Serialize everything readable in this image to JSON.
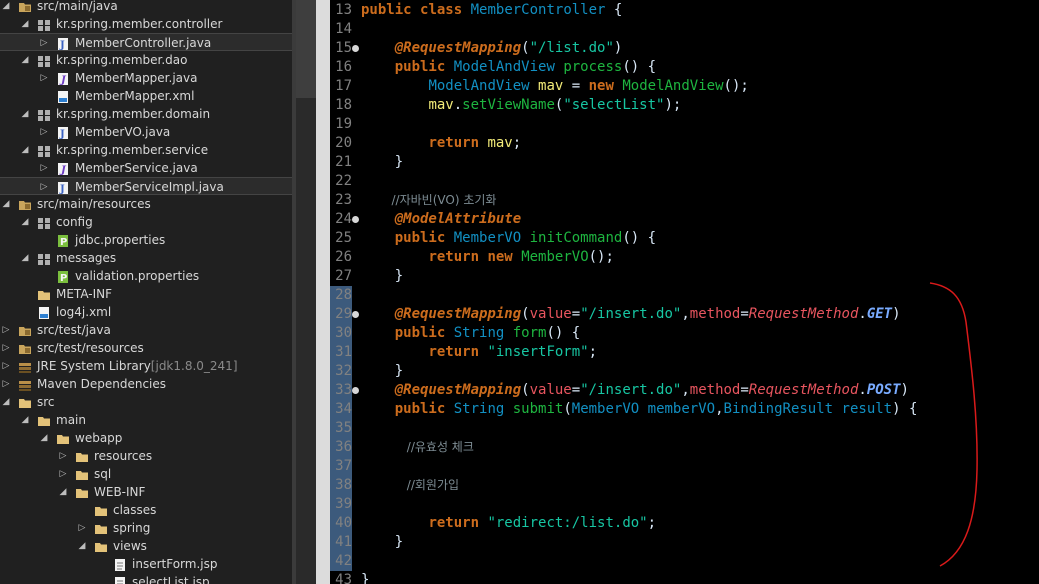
{
  "explorer": {
    "items": [
      {
        "label": "src/main/java",
        "depth": 1,
        "arrow": "down",
        "icon": "package-folder",
        "dim": ""
      },
      {
        "label": "kr.spring.member.controller",
        "depth": 2,
        "arrow": "down",
        "icon": "package",
        "dim": ""
      },
      {
        "label": "MemberController.java",
        "depth": 3,
        "arrow": "right",
        "icon": "java-file",
        "dim": "",
        "selected": true
      },
      {
        "label": "kr.spring.member.dao",
        "depth": 2,
        "arrow": "down",
        "icon": "package",
        "dim": ""
      },
      {
        "label": "MemberMapper.java",
        "depth": 3,
        "arrow": "right",
        "icon": "java-interface",
        "dim": ""
      },
      {
        "label": "MemberMapper.xml",
        "depth": 3,
        "arrow": "",
        "icon": "xml-file",
        "dim": ""
      },
      {
        "label": "kr.spring.member.domain",
        "depth": 2,
        "arrow": "down",
        "icon": "package",
        "dim": ""
      },
      {
        "label": "MemberVO.java",
        "depth": 3,
        "arrow": "right",
        "icon": "java-file",
        "dim": ""
      },
      {
        "label": "kr.spring.member.service",
        "depth": 2,
        "arrow": "down",
        "icon": "package",
        "dim": ""
      },
      {
        "label": "MemberService.java",
        "depth": 3,
        "arrow": "right",
        "icon": "java-interface",
        "dim": ""
      },
      {
        "label": "MemberServiceImpl.java",
        "depth": 3,
        "arrow": "right",
        "icon": "java-file",
        "dim": "",
        "selected": true
      },
      {
        "label": "src/main/resources",
        "depth": 1,
        "arrow": "down",
        "icon": "package-folder",
        "dim": ""
      },
      {
        "label": "config",
        "depth": 2,
        "arrow": "down",
        "icon": "package",
        "dim": ""
      },
      {
        "label": "jdbc.properties",
        "depth": 3,
        "arrow": "",
        "icon": "properties-file",
        "dim": ""
      },
      {
        "label": "messages",
        "depth": 2,
        "arrow": "down",
        "icon": "package",
        "dim": ""
      },
      {
        "label": "validation.properties",
        "depth": 3,
        "arrow": "",
        "icon": "properties-file",
        "dim": ""
      },
      {
        "label": "META-INF",
        "depth": 2,
        "arrow": "",
        "icon": "folder",
        "dim": ""
      },
      {
        "label": "log4j.xml",
        "depth": 2,
        "arrow": "",
        "icon": "xml-file",
        "dim": ""
      },
      {
        "label": "src/test/java",
        "depth": 1,
        "arrow": "right",
        "icon": "package-folder",
        "dim": ""
      },
      {
        "label": "src/test/resources",
        "depth": 1,
        "arrow": "right",
        "icon": "package-folder",
        "dim": ""
      },
      {
        "label": "JRE System Library",
        "depth": 1,
        "arrow": "right",
        "icon": "library",
        "dim": "[jdk1.8.0_241]"
      },
      {
        "label": "Maven Dependencies",
        "depth": 1,
        "arrow": "right",
        "icon": "library",
        "dim": ""
      },
      {
        "label": "src",
        "depth": 1,
        "arrow": "down",
        "icon": "folder",
        "dim": ""
      },
      {
        "label": "main",
        "depth": 2,
        "arrow": "down",
        "icon": "folder",
        "dim": ""
      },
      {
        "label": "webapp",
        "depth": 3,
        "arrow": "down",
        "icon": "folder",
        "dim": ""
      },
      {
        "label": "resources",
        "depth": 4,
        "arrow": "right",
        "icon": "folder",
        "dim": ""
      },
      {
        "label": "sql",
        "depth": 4,
        "arrow": "right",
        "icon": "folder",
        "dim": ""
      },
      {
        "label": "WEB-INF",
        "depth": 4,
        "arrow": "down",
        "icon": "folder",
        "dim": ""
      },
      {
        "label": "classes",
        "depth": 5,
        "arrow": "",
        "icon": "folder",
        "dim": ""
      },
      {
        "label": "spring",
        "depth": 5,
        "arrow": "right",
        "icon": "folder",
        "dim": ""
      },
      {
        "label": "views",
        "depth": 5,
        "arrow": "down",
        "icon": "folder",
        "dim": ""
      },
      {
        "label": "insertForm.jsp",
        "depth": 6,
        "arrow": "",
        "icon": "jsp-file",
        "dim": ""
      },
      {
        "label": "selectList.jsp",
        "depth": 6,
        "arrow": "",
        "icon": "jsp-file",
        "dim": ""
      }
    ]
  },
  "editor": {
    "lines": [
      {
        "n": "13",
        "fold": false,
        "hl": false,
        "tokens": [
          [
            "kw",
            "public"
          ],
          [
            "pl",
            " "
          ],
          [
            "kw",
            "class"
          ],
          [
            "pl",
            " "
          ],
          [
            "ty",
            "MemberController"
          ],
          [
            "pl",
            " {"
          ]
        ]
      },
      {
        "n": "14",
        "fold": false,
        "hl": false,
        "tokens": []
      },
      {
        "n": "15",
        "fold": true,
        "hl": false,
        "tokens": [
          [
            "pl",
            "    "
          ],
          [
            "an",
            "@RequestMapping"
          ],
          [
            "pl",
            "("
          ],
          [
            "st",
            "\"/list.do\""
          ],
          [
            "pl",
            ")"
          ]
        ]
      },
      {
        "n": "16",
        "fold": false,
        "hl": false,
        "tokens": [
          [
            "pl",
            "    "
          ],
          [
            "kw",
            "public"
          ],
          [
            "pl",
            " "
          ],
          [
            "ty",
            "ModelAndView"
          ],
          [
            "pl",
            " "
          ],
          [
            "mt",
            "process"
          ],
          [
            "pl",
            "() {"
          ]
        ]
      },
      {
        "n": "17",
        "fold": false,
        "hl": false,
        "tokens": [
          [
            "pl",
            "        "
          ],
          [
            "ty",
            "ModelAndView"
          ],
          [
            "pl",
            " "
          ],
          [
            "lv",
            "mav"
          ],
          [
            "pl",
            " = "
          ],
          [
            "kw",
            "new"
          ],
          [
            "pl",
            " "
          ],
          [
            "mt",
            "ModelAndView"
          ],
          [
            "pl",
            "();"
          ]
        ]
      },
      {
        "n": "18",
        "fold": false,
        "hl": false,
        "tokens": [
          [
            "pl",
            "        "
          ],
          [
            "lv",
            "mav"
          ],
          [
            "pl",
            "."
          ],
          [
            "mt",
            "setViewName"
          ],
          [
            "pl",
            "("
          ],
          [
            "st",
            "\"selectList\""
          ],
          [
            "pl",
            ");"
          ]
        ]
      },
      {
        "n": "19",
        "fold": false,
        "hl": false,
        "tokens": []
      },
      {
        "n": "20",
        "fold": false,
        "hl": false,
        "tokens": [
          [
            "pl",
            "        "
          ],
          [
            "kw",
            "return"
          ],
          [
            "pl",
            " "
          ],
          [
            "lv",
            "mav"
          ],
          [
            "pl",
            ";"
          ]
        ]
      },
      {
        "n": "21",
        "fold": false,
        "hl": false,
        "tokens": [
          [
            "pl",
            "    }"
          ]
        ]
      },
      {
        "n": "22",
        "fold": false,
        "hl": false,
        "tokens": []
      },
      {
        "n": "23",
        "fold": false,
        "hl": false,
        "comment": true,
        "text": "        //자바빈(VO) 초기화"
      },
      {
        "n": "24",
        "fold": true,
        "hl": false,
        "tokens": [
          [
            "pl",
            "    "
          ],
          [
            "an",
            "@ModelAttribute"
          ]
        ]
      },
      {
        "n": "25",
        "fold": false,
        "hl": false,
        "tokens": [
          [
            "pl",
            "    "
          ],
          [
            "kw",
            "public"
          ],
          [
            "pl",
            " "
          ],
          [
            "ty",
            "MemberVO"
          ],
          [
            "pl",
            " "
          ],
          [
            "mt",
            "initCommand"
          ],
          [
            "pl",
            "() {"
          ]
        ]
      },
      {
        "n": "26",
        "fold": false,
        "hl": false,
        "tokens": [
          [
            "pl",
            "        "
          ],
          [
            "kw",
            "return"
          ],
          [
            "pl",
            " "
          ],
          [
            "kw",
            "new"
          ],
          [
            "pl",
            " "
          ],
          [
            "mt",
            "MemberVO"
          ],
          [
            "pl",
            "();"
          ]
        ]
      },
      {
        "n": "27",
        "fold": false,
        "hl": false,
        "tokens": [
          [
            "pl",
            "    }"
          ]
        ]
      },
      {
        "n": "28",
        "fold": false,
        "hl": true,
        "tokens": []
      },
      {
        "n": "29",
        "fold": true,
        "hl": true,
        "tokens": [
          [
            "pl",
            "    "
          ],
          [
            "an",
            "@RequestMapping"
          ],
          [
            "pl",
            "("
          ],
          [
            "at",
            "value"
          ],
          [
            "pl",
            "="
          ],
          [
            "st",
            "\"/insert.do\""
          ],
          [
            "pl",
            ","
          ],
          [
            "at",
            "method"
          ],
          [
            "pl",
            "="
          ],
          [
            "en",
            "RequestMethod"
          ],
          [
            "pl",
            "."
          ],
          [
            "ec",
            "GET"
          ],
          [
            "pl",
            ")"
          ]
        ]
      },
      {
        "n": "30",
        "fold": false,
        "hl": true,
        "tokens": [
          [
            "pl",
            "    "
          ],
          [
            "kw",
            "public"
          ],
          [
            "pl",
            " "
          ],
          [
            "ty",
            "String"
          ],
          [
            "pl",
            " "
          ],
          [
            "mt",
            "form"
          ],
          [
            "pl",
            "() {"
          ]
        ]
      },
      {
        "n": "31",
        "fold": false,
        "hl": true,
        "tokens": [
          [
            "pl",
            "        "
          ],
          [
            "kw",
            "return"
          ],
          [
            "pl",
            " "
          ],
          [
            "st",
            "\"insertForm\""
          ],
          [
            "pl",
            ";"
          ]
        ]
      },
      {
        "n": "32",
        "fold": false,
        "hl": true,
        "tokens": [
          [
            "pl",
            "    }"
          ]
        ]
      },
      {
        "n": "33",
        "fold": true,
        "hl": true,
        "tokens": [
          [
            "pl",
            "    "
          ],
          [
            "an",
            "@RequestMapping"
          ],
          [
            "pl",
            "("
          ],
          [
            "at",
            "value"
          ],
          [
            "pl",
            "="
          ],
          [
            "st",
            "\"/insert.do\""
          ],
          [
            "pl",
            ","
          ],
          [
            "at",
            "method"
          ],
          [
            "pl",
            "="
          ],
          [
            "en",
            "RequestMethod"
          ],
          [
            "pl",
            "."
          ],
          [
            "ec",
            "POST"
          ],
          [
            "pl",
            ")"
          ]
        ]
      },
      {
        "n": "34",
        "fold": false,
        "hl": true,
        "tokens": [
          [
            "pl",
            "    "
          ],
          [
            "kw",
            "public"
          ],
          [
            "pl",
            " "
          ],
          [
            "ty",
            "String"
          ],
          [
            "pl",
            " "
          ],
          [
            "mt",
            "submit"
          ],
          [
            "pl",
            "("
          ],
          [
            "ty",
            "MemberVO"
          ],
          [
            "pl",
            " "
          ],
          [
            "ty",
            "memberVO"
          ],
          [
            "pl",
            ","
          ],
          [
            "ty",
            "BindingResult"
          ],
          [
            "pl",
            " "
          ],
          [
            "ty",
            "result"
          ],
          [
            "pl",
            ") {"
          ]
        ]
      },
      {
        "n": "35",
        "fold": false,
        "hl": true,
        "tokens": []
      },
      {
        "n": "36",
        "fold": false,
        "hl": true,
        "comment": true,
        "text": "            //유효성 체크"
      },
      {
        "n": "37",
        "fold": false,
        "hl": true,
        "tokens": []
      },
      {
        "n": "38",
        "fold": false,
        "hl": true,
        "comment": true,
        "text": "            //회원가입"
      },
      {
        "n": "39",
        "fold": false,
        "hl": true,
        "tokens": []
      },
      {
        "n": "40",
        "fold": false,
        "hl": true,
        "tokens": [
          [
            "pl",
            "        "
          ],
          [
            "kw",
            "return"
          ],
          [
            "pl",
            " "
          ],
          [
            "st",
            "\"redirect:/list.do\""
          ],
          [
            "pl",
            ";"
          ]
        ]
      },
      {
        "n": "41",
        "fold": false,
        "hl": true,
        "tokens": [
          [
            "pl",
            "    }"
          ]
        ]
      },
      {
        "n": "42",
        "fold": false,
        "hl": true,
        "tokens": []
      },
      {
        "n": "43",
        "fold": false,
        "hl": false,
        "tokens": [
          [
            "pl",
            "}"
          ]
        ]
      }
    ]
  },
  "annotation": {
    "color": "#d91a1a"
  }
}
